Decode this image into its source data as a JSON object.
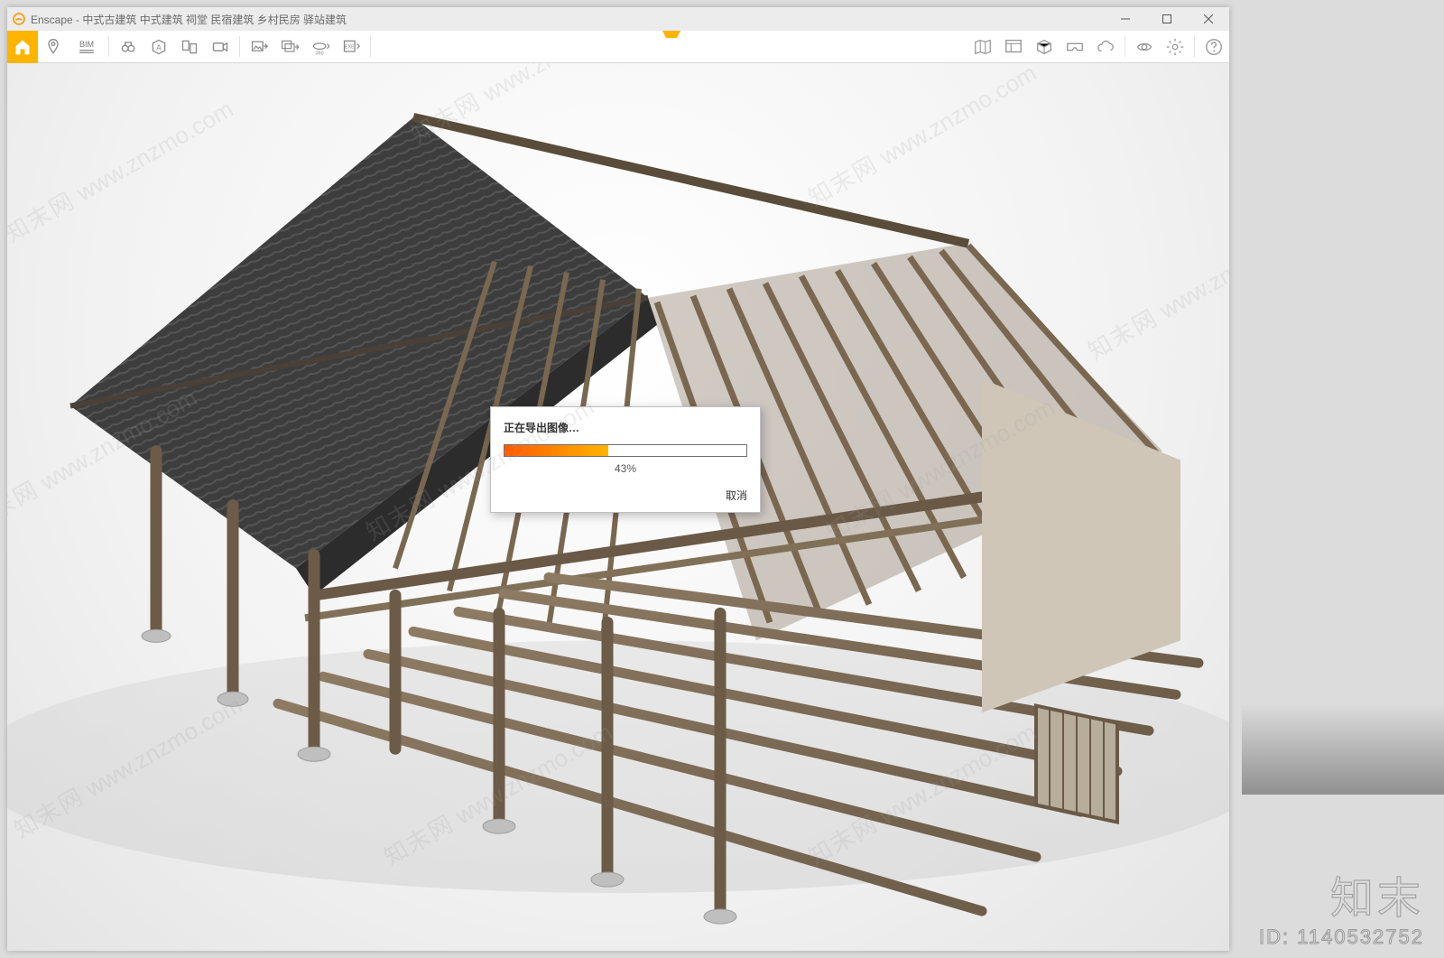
{
  "window": {
    "title": "Enscape - 中式古建筑 中式建筑 祠堂 民宿建筑 乡村民房 驿站建筑"
  },
  "toolbar": {
    "bim_label": "BIM"
  },
  "dialog": {
    "title": "正在导出图像…",
    "progress_percent": 43,
    "progress_text": "43%",
    "cancel_label": "取消"
  },
  "watermark": {
    "logo_text": "知末",
    "id_label": "ID: 1140532752",
    "diag_cn": "知末网",
    "diag_url": "www.znzmo.com"
  },
  "colors": {
    "accent": "#ffb400",
    "progress_start": "#ff5a00",
    "progress_end": "#ffb400"
  }
}
